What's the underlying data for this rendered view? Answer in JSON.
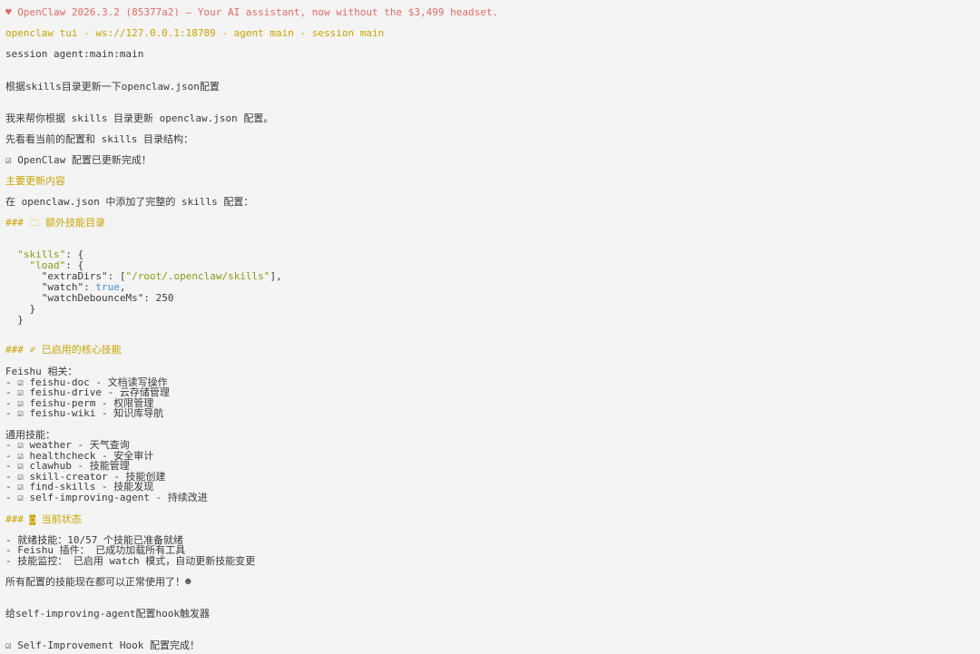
{
  "header": {
    "banner_prefix": "♥ ",
    "banner_title": "OpenClaw 2026.3.2 (85377a2)",
    "banner_tagline": " — Your AI assistant, now without the $3,499 headset.",
    "connection": "openclaw tui - ws://127.0.0.1:18789 - agent main - session main",
    "session": "session agent:main:main"
  },
  "messages": {
    "user_1": "根据skills目录更新一下openclaw.json配置",
    "reply_1": "我来帮你根据 skills 目录更新 openclaw.json 配置。",
    "reply_2": "先看看当前的配置和 skills 目录结构：",
    "done_1": "☑ OpenClaw 配置已更新完成！",
    "section_main": "主要更新内容",
    "added_line": "在 openclaw.json 中添加了完整的 skills 配置：",
    "heading_extra": "### 🗀 额外技能目录",
    "code": {
      "l1_key": "\"skills\"",
      "l1_rest": ": {",
      "l2_key": "\"load\"",
      "l2_rest": ": {",
      "l3_key": "\"extraDirs\"",
      "l3_mid": ": [",
      "l3_val": "\"/root/.openclaw/skills\"",
      "l3_end": "],",
      "l4_key": "\"watch\"",
      "l4_mid": ": ",
      "l4_val": "true",
      "l4_end": ",",
      "l5_key": "\"watchDebounceMs\"",
      "l5_rest": ": 250",
      "l6": "}",
      "l7": "}"
    },
    "heading_core": "### ✐ 已启用的核心技能",
    "feishu_title": "Feishu 相关：",
    "feishu_items": [
      "- ☑ feishu-doc - 文档读写操作",
      "- ☑ feishu-drive - 云存储管理",
      "- ☑ feishu-perm - 权限管理",
      "- ☑ feishu-wiki - 知识库导航"
    ],
    "general_title": "通用技能：",
    "general_items": [
      "- ☑ weather - 天气查询",
      "- ☑ healthcheck - 安全审计",
      "- ☑ clawhub - 技能管理",
      "- ☑ skill-creator - 技能创建",
      "- ☑ find-skills - 技能发现",
      "- ☑ self-improving-agent - 持续改进"
    ],
    "heading_status": "### ◙ 当前状态",
    "status_items": [
      "- 就绪技能：10/57 个技能已准备就绪",
      "- Feishu 插件： 已成功加载所有工具",
      "- 技能监控： 已启用 watch 模式，自动更新技能变更"
    ],
    "summary": "所有配置的技能现在都可以正常使用了！☻",
    "user_2": "给self-improving-agent配置hook触发器",
    "done_2": "☑ Self-Improvement Hook 配置完成！"
  }
}
